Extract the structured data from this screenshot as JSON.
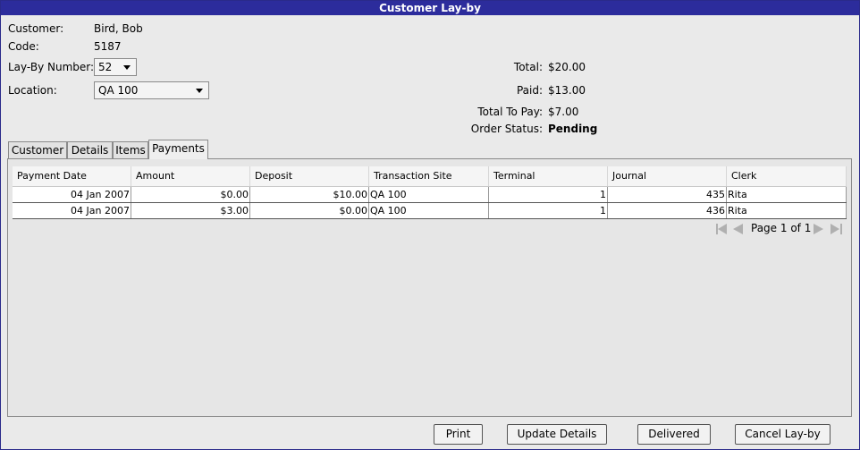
{
  "window": {
    "title": "Customer Lay-by"
  },
  "form": {
    "customer_label": "Customer:",
    "customer_value": "Bird, Bob",
    "code_label": "Code:",
    "code_value": "5187",
    "laybynum_label": "Lay-By Number:",
    "laybynum_value": "52",
    "location_label": "Location:",
    "location_value": "QA 100"
  },
  "summary": {
    "total_label": "Total:",
    "total_value": "$20.00",
    "paid_label": "Paid:",
    "paid_value": "$13.00",
    "ttp_label": "Total To Pay:",
    "ttp_value": "$7.00",
    "status_label": "Order Status:",
    "status_value": "Pending"
  },
  "tabs": [
    {
      "label": "Customer",
      "active": false
    },
    {
      "label": "Details",
      "active": false
    },
    {
      "label": "Items",
      "active": false
    },
    {
      "label": "Payments",
      "active": true
    }
  ],
  "table": {
    "columns": [
      "Payment Date",
      "Amount",
      "Deposit",
      "Transaction Site",
      "Terminal",
      "Journal",
      "Clerk"
    ],
    "rows": [
      [
        "04 Jan 2007",
        "$0.00",
        "$10.00",
        "QA 100",
        "1",
        "435",
        "Rita"
      ],
      [
        "04 Jan 2007",
        "$3.00",
        "$0.00",
        "QA 100",
        "1",
        "436",
        "Rita"
      ]
    ]
  },
  "pager": {
    "text": "Page 1 of 1"
  },
  "buttons": {
    "print": "Print",
    "update": "Update Details",
    "delivered": "Delivered",
    "cancel": "Cancel Lay-by"
  },
  "colors": {
    "titlebar": "#2c2c9c",
    "background": "#eaeaea"
  }
}
